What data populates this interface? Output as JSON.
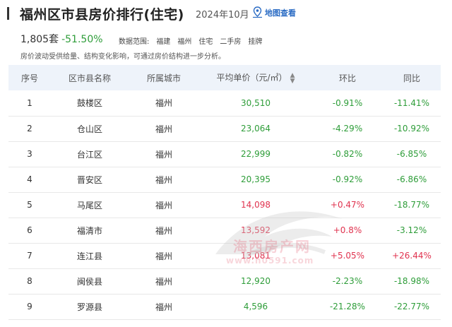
{
  "header": {
    "title": "福州区市县房价排行(住宅)",
    "date": "2024年10月",
    "map_link": "地图查看"
  },
  "stats": {
    "count": "1,805套",
    "change": "-51.50%",
    "scope_label": "数据范围:",
    "scope_items": [
      "福建",
      "福州",
      "住宅",
      "二手房",
      "挂牌"
    ]
  },
  "note": "房价波动受供给量、结构变化影响，可通过房价结构进一步分析。",
  "table": {
    "headers": [
      "序号",
      "区市县名称",
      "所属城市",
      "平均单价（元/㎡）",
      "环比",
      "同比"
    ],
    "rows": [
      {
        "idx": "1",
        "name": "鼓楼区",
        "city": "福州",
        "price": "30,510",
        "mom": "-0.91%",
        "yoy": "-11.41%"
      },
      {
        "idx": "2",
        "name": "仓山区",
        "city": "福州",
        "price": "23,064",
        "mom": "-4.29%",
        "yoy": "-10.92%"
      },
      {
        "idx": "3",
        "name": "台江区",
        "city": "福州",
        "price": "22,999",
        "mom": "-0.82%",
        "yoy": "-6.85%"
      },
      {
        "idx": "4",
        "name": "晋安区",
        "city": "福州",
        "price": "20,395",
        "mom": "-0.92%",
        "yoy": "-6.86%"
      },
      {
        "idx": "5",
        "name": "马尾区",
        "city": "福州",
        "price": "14,098",
        "mom": "+0.47%",
        "yoy": "-18.77%"
      },
      {
        "idx": "6",
        "name": "福清市",
        "city": "福州",
        "price": "13,592",
        "mom": "+0.8%",
        "yoy": "-3.12%"
      },
      {
        "idx": "7",
        "name": "连江县",
        "city": "福州",
        "price": "13,081",
        "mom": "+5.05%",
        "yoy": "+26.44%"
      },
      {
        "idx": "8",
        "name": "闽侯县",
        "city": "福州",
        "price": "12,920",
        "mom": "-2.23%",
        "yoy": "-18.98%"
      },
      {
        "idx": "9",
        "name": "罗源县",
        "city": "福州",
        "price": "4,596",
        "mom": "-21.28%",
        "yoy": "-22.77%"
      }
    ]
  },
  "watermark": {
    "text": "海西房产网",
    "url": "www.h0591.com"
  },
  "colors": {
    "positive": "#e0334f",
    "negative": "#2e9d39",
    "link": "#2b6cc4",
    "header_bg": "#eef3fa"
  }
}
